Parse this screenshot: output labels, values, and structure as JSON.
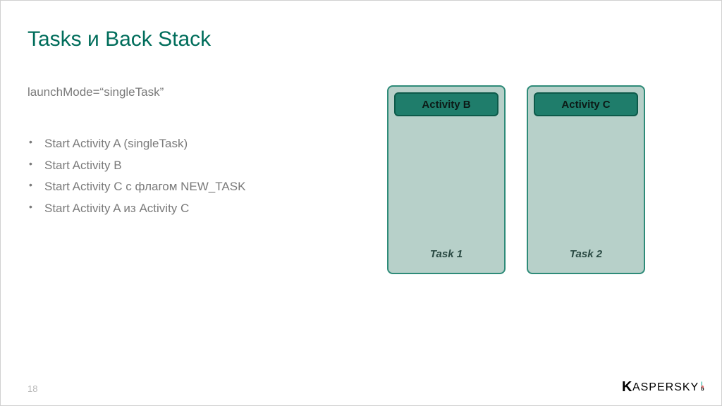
{
  "title": "Tasks и Back Stack",
  "subtitle": "launchMode=“singleTask”",
  "bullets": [
    "Start Activity A (singleTask)",
    "Start Activity B",
    "Start Activity C с флагом NEW_TASK",
    "Start Activity A из Activity C"
  ],
  "tasks": [
    {
      "activity": "Activity B",
      "label": "Task 1"
    },
    {
      "activity": "Activity C",
      "label": "Task 2"
    }
  ],
  "pageNumber": "18",
  "brand": {
    "first": "K",
    "rest": "ASPERSKY",
    "lab": [
      "l",
      "a",
      "b"
    ]
  },
  "colors": {
    "titleGreen": "#006d5b",
    "taskFill": "#b7d0c9",
    "taskBorder": "#2e8b78",
    "chipFill": "#1f7d6b"
  }
}
